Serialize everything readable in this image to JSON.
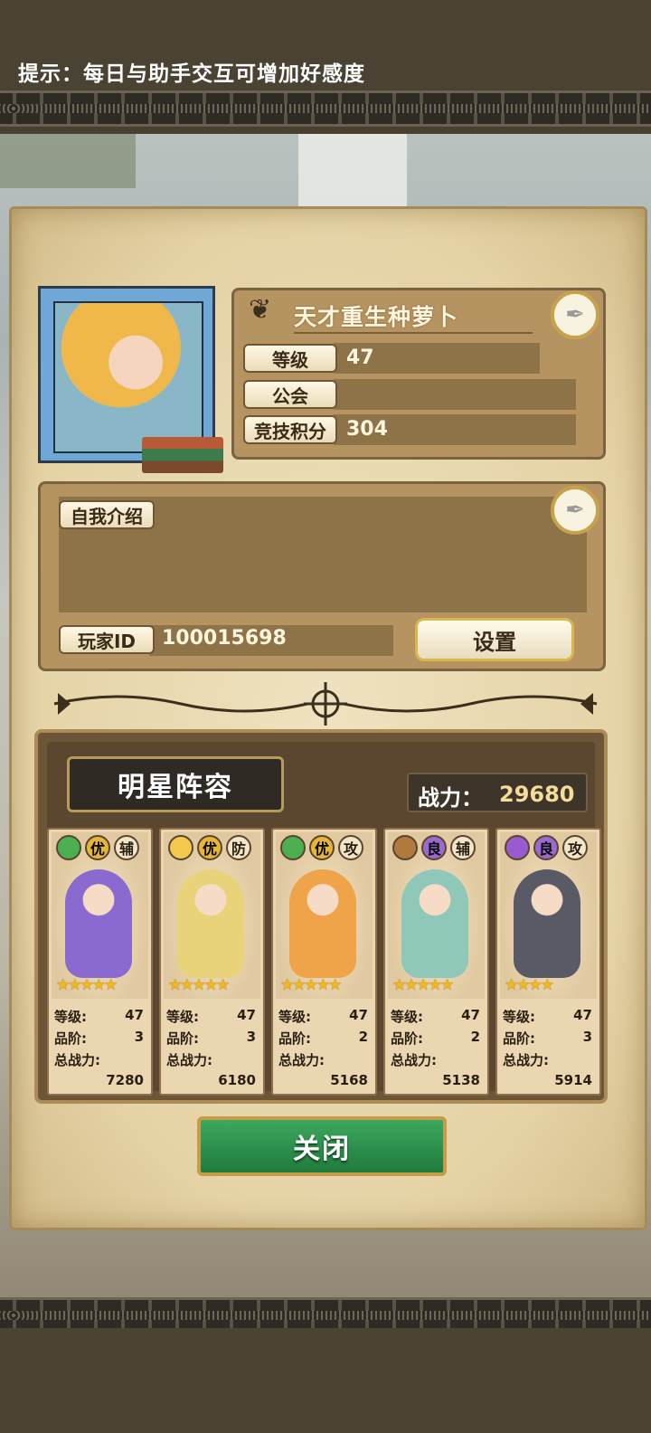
{
  "hint": "提示：每日与助手交互可增加好感度",
  "profile": {
    "name": "天才重生种萝卜",
    "level_label": "等级",
    "level": "47",
    "guild_label": "公会",
    "guild": "",
    "arena_label": "竞技积分",
    "arena": "304"
  },
  "intro": {
    "label": "自我介绍",
    "text": "",
    "player_id_label": "玩家ID",
    "player_id": "100015698",
    "settings_label": "设置"
  },
  "team": {
    "title": "明星阵容",
    "power_label": "战力：",
    "power": "29680",
    "stat_labels": {
      "level": "等级:",
      "grade": "品阶:",
      "total": "总战力:"
    },
    "heroes": [
      {
        "element_icon": "leaf-icon",
        "element_color": "#4caf50",
        "rank": "优",
        "rank_color": "#e6b53a",
        "role": "辅",
        "stars": "★★★★★",
        "level": "47",
        "grade": "3",
        "power": "7280",
        "color": "#8a6ad0"
      },
      {
        "element_icon": "sun-icon",
        "element_color": "#f2c94c",
        "rank": "优",
        "rank_color": "#e6b53a",
        "role": "防",
        "stars": "★★★★★",
        "level": "47",
        "grade": "3",
        "power": "6180",
        "color": "#e9d37a"
      },
      {
        "element_icon": "leaf-icon",
        "element_color": "#4caf50",
        "rank": "优",
        "rank_color": "#e6b53a",
        "role": "攻",
        "stars": "★★★★★",
        "level": "47",
        "grade": "2",
        "power": "5168",
        "color": "#f0a44a"
      },
      {
        "element_icon": "mountain-icon",
        "element_color": "#b07a3e",
        "rank": "良",
        "rank_color": "#9a6ad0",
        "role": "辅",
        "stars": "★★★★★",
        "level": "47",
        "grade": "2",
        "power": "5138",
        "color": "#8fc7b8"
      },
      {
        "element_icon": "swirl-icon",
        "element_color": "#9a5ad0",
        "rank": "良",
        "rank_color": "#9a6ad0",
        "role": "攻",
        "stars": "★★★★",
        "level": "47",
        "grade": "3",
        "power": "5914",
        "color": "#5a5a66"
      }
    ]
  },
  "close_label": "关闭"
}
